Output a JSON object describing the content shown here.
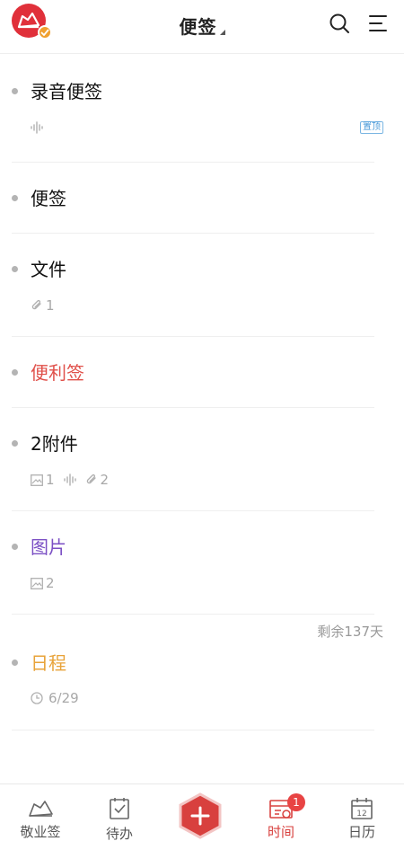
{
  "header": {
    "title": "便签"
  },
  "notes": [
    {
      "title": "录音便签",
      "color": "#111111",
      "pin_label": "置顶"
    },
    {
      "title": "便签",
      "color": "#111111"
    },
    {
      "title": "文件",
      "color": "#111111",
      "attachments": "1"
    },
    {
      "title": "便利签",
      "color": "#e0504a"
    },
    {
      "title": "2附件",
      "color": "#111111",
      "images": "1",
      "attachments": "2"
    },
    {
      "title": "图片",
      "color": "#7b4fc4",
      "images": "2"
    },
    {
      "title": "日程",
      "color": "#e8a33a",
      "date": "6/29",
      "remaining": "剩余137天"
    }
  ],
  "bottom_nav": {
    "items": [
      {
        "label": "敬业签",
        "icon": "note-logo-icon"
      },
      {
        "label": "待办",
        "icon": "todo-check-icon"
      },
      {
        "label": "时间",
        "icon": "timeline-icon",
        "badge": "1",
        "active": true
      },
      {
        "label": "日历",
        "icon": "calendar-icon",
        "day": "12"
      }
    ],
    "add_icon": "plus-icon"
  },
  "colors": {
    "accent": "#d8403e",
    "purple": "#7b4fc4",
    "orange": "#e8a33a",
    "badge_blue": "#4a9ad8"
  }
}
